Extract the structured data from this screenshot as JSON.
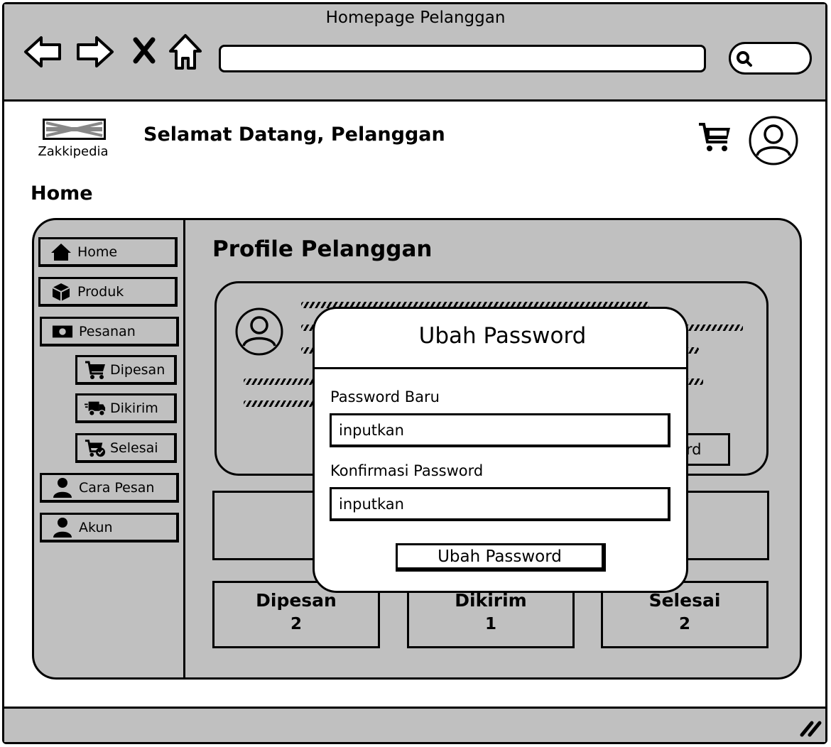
{
  "window": {
    "title": "Homepage Pelanggan"
  },
  "browser": {
    "icons": [
      "back-arrow-icon",
      "forward-arrow-icon",
      "close-x-icon",
      "home-icon",
      "search-icon"
    ],
    "address_value": ""
  },
  "header": {
    "logo_text": "Zakkipedia",
    "welcome": "Selamat Datang, Pelanggan",
    "icons": [
      "cart-icon",
      "user-avatar-icon"
    ]
  },
  "page": {
    "heading": "Home"
  },
  "sidebar": {
    "items": [
      {
        "label": "Home",
        "icon": "home-icon"
      },
      {
        "label": "Produk",
        "icon": "box-icon"
      },
      {
        "label": "Pesanan",
        "icon": "money-icon"
      },
      {
        "label": "Dipesan",
        "icon": "cart-icon"
      },
      {
        "label": "Dikirim",
        "icon": "truck-icon"
      },
      {
        "label": "Selesai",
        "icon": "cart-check-icon"
      },
      {
        "label": "Cara Pesan",
        "icon": "user-icon"
      },
      {
        "label": "Akun",
        "icon": "user-icon"
      }
    ]
  },
  "main": {
    "title": "Profile Pelanggan",
    "card_button_label": "ord",
    "stats": [
      {
        "label": "Dipesan",
        "value": "2"
      },
      {
        "label": "Dikirim",
        "value": "1"
      },
      {
        "label": "Selesai",
        "value": "2"
      }
    ]
  },
  "modal": {
    "title": "Ubah Password",
    "fields": [
      {
        "label": "Password Baru",
        "value": "inputkan"
      },
      {
        "label": "Konfirmasi Password",
        "value": "inputkan"
      }
    ],
    "submit_label": "Ubah Password"
  },
  "colors": {
    "chrome": "#c0c0c0",
    "ink": "#000000",
    "surface": "#ffffff"
  }
}
